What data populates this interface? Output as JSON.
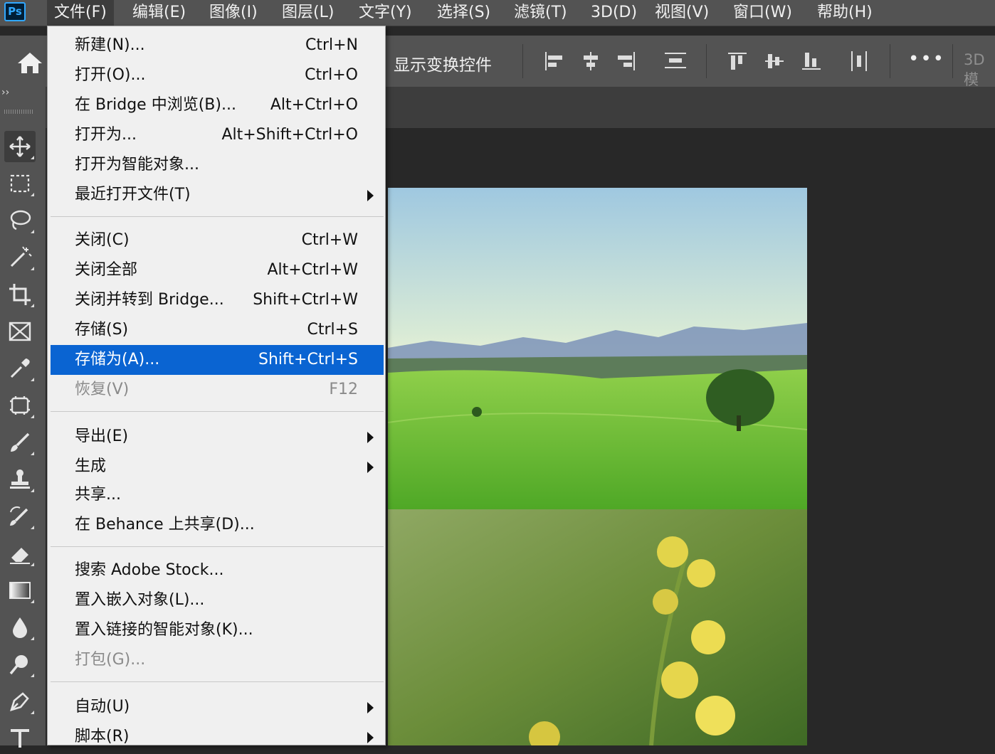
{
  "app": {
    "logo": "Ps"
  },
  "menubar": {
    "items": [
      {
        "label": "文件(F)",
        "active": true
      },
      {
        "label": "编辑(E)"
      },
      {
        "label": "图像(I)"
      },
      {
        "label": "图层(L)"
      },
      {
        "label": "文字(Y)"
      },
      {
        "label": "选择(S)"
      },
      {
        "label": "滤镜(T)"
      },
      {
        "label": "3D(D)"
      },
      {
        "label": "视图(V)"
      },
      {
        "label": "窗口(W)"
      },
      {
        "label": "帮助(H)"
      }
    ]
  },
  "options": {
    "transform_label": "显示变换控件",
    "more": "•••",
    "mode3d": "3D 模"
  },
  "toolbar": {
    "collapse": "››",
    "tools": [
      {
        "name": "move-tool-icon",
        "selected": true
      },
      {
        "name": "marquee-tool-icon"
      },
      {
        "name": "lasso-tool-icon"
      },
      {
        "name": "magic-wand-tool-icon"
      },
      {
        "name": "crop-tool-icon"
      },
      {
        "name": "frame-tool-icon"
      },
      {
        "name": "eyedropper-tool-icon"
      },
      {
        "name": "patch-tool-icon"
      },
      {
        "name": "brush-tool-icon"
      },
      {
        "name": "clone-stamp-tool-icon"
      },
      {
        "name": "history-brush-tool-icon"
      },
      {
        "name": "eraser-tool-icon"
      },
      {
        "name": "gradient-tool-icon"
      },
      {
        "name": "blur-tool-icon"
      },
      {
        "name": "dodge-tool-icon"
      },
      {
        "name": "pen-tool-icon"
      },
      {
        "name": "type-tool-icon"
      }
    ]
  },
  "file_menu": {
    "items": [
      {
        "label": "新建(N)...",
        "shortcut": "Ctrl+N"
      },
      {
        "label": "打开(O)...",
        "shortcut": "Ctrl+O"
      },
      {
        "label": "在 Bridge 中浏览(B)...",
        "shortcut": "Alt+Ctrl+O"
      },
      {
        "label": "打开为...",
        "shortcut": "Alt+Shift+Ctrl+O"
      },
      {
        "label": "打开为智能对象..."
      },
      {
        "label": "最近打开文件(T)",
        "submenu": true
      },
      {
        "label": "关闭(C)",
        "shortcut": "Ctrl+W"
      },
      {
        "label": "关闭全部",
        "shortcut": "Alt+Ctrl+W"
      },
      {
        "label": "关闭并转到 Bridge...",
        "shortcut": "Shift+Ctrl+W"
      },
      {
        "label": "存储(S)",
        "shortcut": "Ctrl+S"
      },
      {
        "label": "存储为(A)...",
        "shortcut": "Shift+Ctrl+S",
        "highlighted": true
      },
      {
        "label": "恢复(V)",
        "shortcut": "F12",
        "disabled": true
      },
      {
        "label": "导出(E)",
        "submenu": true
      },
      {
        "label": "生成",
        "submenu": true
      },
      {
        "label": "共享..."
      },
      {
        "label": "在 Behance 上共享(D)..."
      },
      {
        "label": "搜索 Adobe Stock..."
      },
      {
        "label": "置入嵌入对象(L)..."
      },
      {
        "label": "置入链接的智能对象(K)..."
      },
      {
        "label": "打包(G)...",
        "disabled": true
      },
      {
        "label": "自动(U)",
        "submenu": true
      },
      {
        "label": "脚本(R)",
        "submenu": true
      }
    ]
  },
  "canvas": {
    "images": [
      "green meadow landscape",
      "yellow rapeseed flowers"
    ]
  },
  "colors": {
    "menubar": "#535353",
    "canvas_bg": "#282828",
    "menu_bg": "#f0f0f0",
    "highlight": "#0a64d2"
  }
}
